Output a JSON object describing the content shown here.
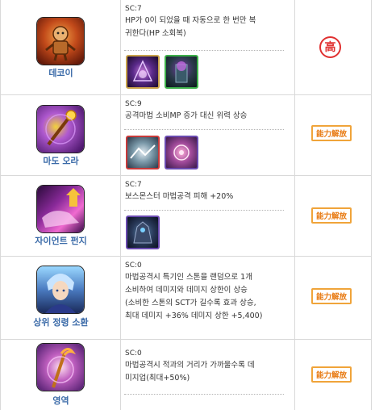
{
  "skills": [
    {
      "name": "데코이",
      "sc": "SC:7",
      "desc": [
        "HP가 0이 되었을 때 자동으로 한 번만 복",
        "귀한다(HP 소회복)"
      ],
      "badge": "高",
      "icon": "decoy-doll-icon"
    },
    {
      "name": "마도 오라",
      "sc": "SC:9",
      "desc": [
        "공격마법 소비MP 증가 대신 위력 상승"
      ],
      "badge": "能力解放",
      "icon": "magic-aura-staff-icon"
    },
    {
      "name": "자이언트 펀지",
      "sc": "SC:7",
      "desc": [
        "보스몬스터 마법공격 피해 +20%"
      ],
      "badge": "能力解放",
      "icon": "giant-punch-icon"
    },
    {
      "name": "상위 정령 소환",
      "sc": "SC:0",
      "desc": [
        "마법공격시 특기인 스톤을 랜덤으로 1개",
        "소비하여 데미지와 데미지 상한이 상승",
        "(소비한 스톤의 SCT가 길수록 효과 상승,",
        "최대 데미지 +36% 데미지 상한 +5,400)"
      ],
      "badge": "能力解放",
      "icon": "spirit-summoner-portrait-icon"
    },
    {
      "name": "영역",
      "sc": "SC:0",
      "desc": [
        "마법공격시 적과의 거리가 가까울수록 데",
        "미지업(최대+50%)"
      ],
      "badge": "能力解放",
      "icon": "territory-staff-icon"
    }
  ]
}
